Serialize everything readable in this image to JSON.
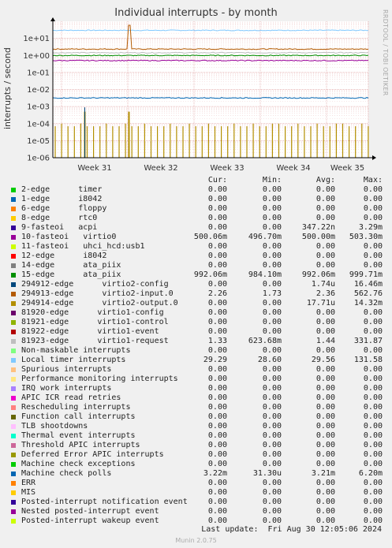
{
  "title": "Individual interrupts - by month",
  "side_text": "RRDTOOL / TOBI OETIKER",
  "munin_version": "Munin 2.0.75",
  "last_update": "Last update:  Fri Aug 30 12:05:06 2024",
  "legend_headers": {
    "cur": "Cur:",
    "min": "Min:",
    "avg": "Avg:",
    "max": "Max:"
  },
  "legend": [
    {
      "name": "2-edge      timer",
      "color": "#00cc00",
      "cur": "0.00",
      "min": "0.00",
      "avg": "0.00",
      "max": "0.00"
    },
    {
      "name": "1-edge      i8042",
      "color": "#0066b3",
      "cur": "0.00",
      "min": "0.00",
      "avg": "0.00",
      "max": "0.00"
    },
    {
      "name": "6-edge      floppy",
      "color": "#ff8000",
      "cur": "0.00",
      "min": "0.00",
      "avg": "0.00",
      "max": "0.00"
    },
    {
      "name": "8-edge      rtc0",
      "color": "#ffcc00",
      "cur": "0.00",
      "min": "0.00",
      "avg": "0.00",
      "max": "0.00"
    },
    {
      "name": "9-fasteoi   acpi",
      "color": "#330099",
      "cur": "0.00",
      "min": "0.00",
      "avg": "347.22n",
      "max": "3.29m"
    },
    {
      "name": "10-fasteoi   virtio0",
      "color": "#990099",
      "cur": "500.06m",
      "min": "496.70m",
      "avg": "500.00m",
      "max": "503.30m"
    },
    {
      "name": "11-fasteoi   uhci_hcd:usb1",
      "color": "#ccff00",
      "cur": "0.00",
      "min": "0.00",
      "avg": "0.00",
      "max": "0.00"
    },
    {
      "name": "12-edge      i8042",
      "color": "#ff0000",
      "cur": "0.00",
      "min": "0.00",
      "avg": "0.00",
      "max": "0.00"
    },
    {
      "name": "14-edge      ata_piix",
      "color": "#808080",
      "cur": "0.00",
      "min": "0.00",
      "avg": "0.00",
      "max": "0.00"
    },
    {
      "name": "15-edge      ata_piix",
      "color": "#008f00",
      "cur": "992.06m",
      "min": "984.10m",
      "avg": "992.06m",
      "max": "999.71m"
    },
    {
      "name": "294912-edge      virtio2-config",
      "color": "#00487d",
      "cur": "0.00",
      "min": "0.00",
      "avg": "1.74u",
      "max": "16.46m"
    },
    {
      "name": "294913-edge      virtio2-input.0",
      "color": "#b35a00",
      "cur": "2.26",
      "min": "1.73",
      "avg": "2.36",
      "max": "562.76"
    },
    {
      "name": "294914-edge      virtio2-output.0",
      "color": "#b38f00",
      "cur": "0.00",
      "min": "0.00",
      "avg": "17.71u",
      "max": "14.32m"
    },
    {
      "name": "81920-edge      virtio1-config",
      "color": "#6b006b",
      "cur": "0.00",
      "min": "0.00",
      "avg": "0.00",
      "max": "0.00"
    },
    {
      "name": "81921-edge      virtio1-control",
      "color": "#8fb300",
      "cur": "0.00",
      "min": "0.00",
      "avg": "0.00",
      "max": "0.00"
    },
    {
      "name": "81922-edge      virtio1-event",
      "color": "#b30000",
      "cur": "0.00",
      "min": "0.00",
      "avg": "0.00",
      "max": "0.00"
    },
    {
      "name": "81923-edge      virtio1-request",
      "color": "#bebebe",
      "cur": "1.33",
      "min": "623.68m",
      "avg": "1.44",
      "max": "331.87"
    },
    {
      "name": "Non-maskable interrupts",
      "color": "#80ff80",
      "cur": "0.00",
      "min": "0.00",
      "avg": "0.00",
      "max": "0.00"
    },
    {
      "name": "Local timer interrupts",
      "color": "#80c9ff",
      "cur": "29.29",
      "min": "28.60",
      "avg": "29.56",
      "max": "131.58"
    },
    {
      "name": "Spurious interrupts",
      "color": "#ffc080",
      "cur": "0.00",
      "min": "0.00",
      "avg": "0.00",
      "max": "0.00"
    },
    {
      "name": "Performance monitoring interrupts",
      "color": "#ffe680",
      "cur": "0.00",
      "min": "0.00",
      "avg": "0.00",
      "max": "0.00"
    },
    {
      "name": "IRQ work interrupts",
      "color": "#aa80ff",
      "cur": "0.00",
      "min": "0.00",
      "avg": "0.00",
      "max": "0.00"
    },
    {
      "name": "APIC ICR read retries",
      "color": "#ee00cc",
      "cur": "0.00",
      "min": "0.00",
      "avg": "0.00",
      "max": "0.00"
    },
    {
      "name": "Rescheduling interrupts",
      "color": "#ff8080",
      "cur": "0.00",
      "min": "0.00",
      "avg": "0.00",
      "max": "0.00"
    },
    {
      "name": "Function call interrupts",
      "color": "#666600",
      "cur": "0.00",
      "min": "0.00",
      "avg": "0.00",
      "max": "0.00"
    },
    {
      "name": "TLB shootdowns",
      "color": "#ffbfff",
      "cur": "0.00",
      "min": "0.00",
      "avg": "0.00",
      "max": "0.00"
    },
    {
      "name": "Thermal event interrupts",
      "color": "#00ffcc",
      "cur": "0.00",
      "min": "0.00",
      "avg": "0.00",
      "max": "0.00"
    },
    {
      "name": "Threshold APIC interrupts",
      "color": "#cc6699",
      "cur": "0.00",
      "min": "0.00",
      "avg": "0.00",
      "max": "0.00"
    },
    {
      "name": "Deferred Error APIC interrupts",
      "color": "#999900",
      "cur": "0.00",
      "min": "0.00",
      "avg": "0.00",
      "max": "0.00"
    },
    {
      "name": "Machine check exceptions",
      "color": "#00cc00",
      "cur": "0.00",
      "min": "0.00",
      "avg": "0.00",
      "max": "0.00"
    },
    {
      "name": "Machine check polls",
      "color": "#0066b3",
      "cur": "3.22m",
      "min": "31.30u",
      "avg": "3.21m",
      "max": "6.20m"
    },
    {
      "name": "ERR",
      "color": "#ff8000",
      "cur": "0.00",
      "min": "0.00",
      "avg": "0.00",
      "max": "0.00"
    },
    {
      "name": "MIS",
      "color": "#ffcc00",
      "cur": "0.00",
      "min": "0.00",
      "avg": "0.00",
      "max": "0.00"
    },
    {
      "name": "Posted-interrupt notification event",
      "color": "#330099",
      "cur": "0.00",
      "min": "0.00",
      "avg": "0.00",
      "max": "0.00"
    },
    {
      "name": "Nested posted-interrupt event",
      "color": "#990099",
      "cur": "0.00",
      "min": "0.00",
      "avg": "0.00",
      "max": "0.00"
    },
    {
      "name": "Posted-interrupt wakeup event",
      "color": "#ccff00",
      "cur": "0.00",
      "min": "0.00",
      "avg": "0.00",
      "max": "0.00"
    }
  ],
  "chart_data": {
    "type": "line",
    "title": "Individual interrupts - by month",
    "ylabel": "interrupts / second",
    "yscale": "log",
    "ylim": [
      1e-06,
      100
    ],
    "yticks": [
      {
        "value": 10,
        "label": "1e+01"
      },
      {
        "value": 1,
        "label": "1e+00"
      },
      {
        "value": 0.1,
        "label": "1e-01"
      },
      {
        "value": 0.01,
        "label": "1e-02"
      },
      {
        "value": 0.001,
        "label": "1e-03"
      },
      {
        "value": 0.0001,
        "label": "1e-04"
      },
      {
        "value": 1e-05,
        "label": "1e-05"
      },
      {
        "value": 1e-06,
        "label": "1e-06"
      }
    ],
    "xticks": [
      "Week 31",
      "Week 32",
      "Week 33",
      "Week 34",
      "Week 35"
    ],
    "grid": true,
    "series": [
      {
        "name": "Local timer interrupts",
        "color": "#80c9ff",
        "level": 29.56
      },
      {
        "name": "294913-edge      virtio2-input.0",
        "color": "#b35a00",
        "level": 2.36,
        "spike_week": 32
      },
      {
        "name": "81923-edge      virtio1-request",
        "color": "#bebebe",
        "level": 1.44
      },
      {
        "name": "15-edge      ata_piix",
        "color": "#008f00",
        "level": 0.992
      },
      {
        "name": "10-fasteoi   virtio0",
        "color": "#990099",
        "level": 0.5
      },
      {
        "name": "Machine check polls",
        "color": "#0066b3",
        "level": 0.00321
      },
      {
        "name": "294914-edge      virtio2-output.0",
        "color": "#b38f00",
        "level": "sparse spikes"
      }
    ]
  }
}
